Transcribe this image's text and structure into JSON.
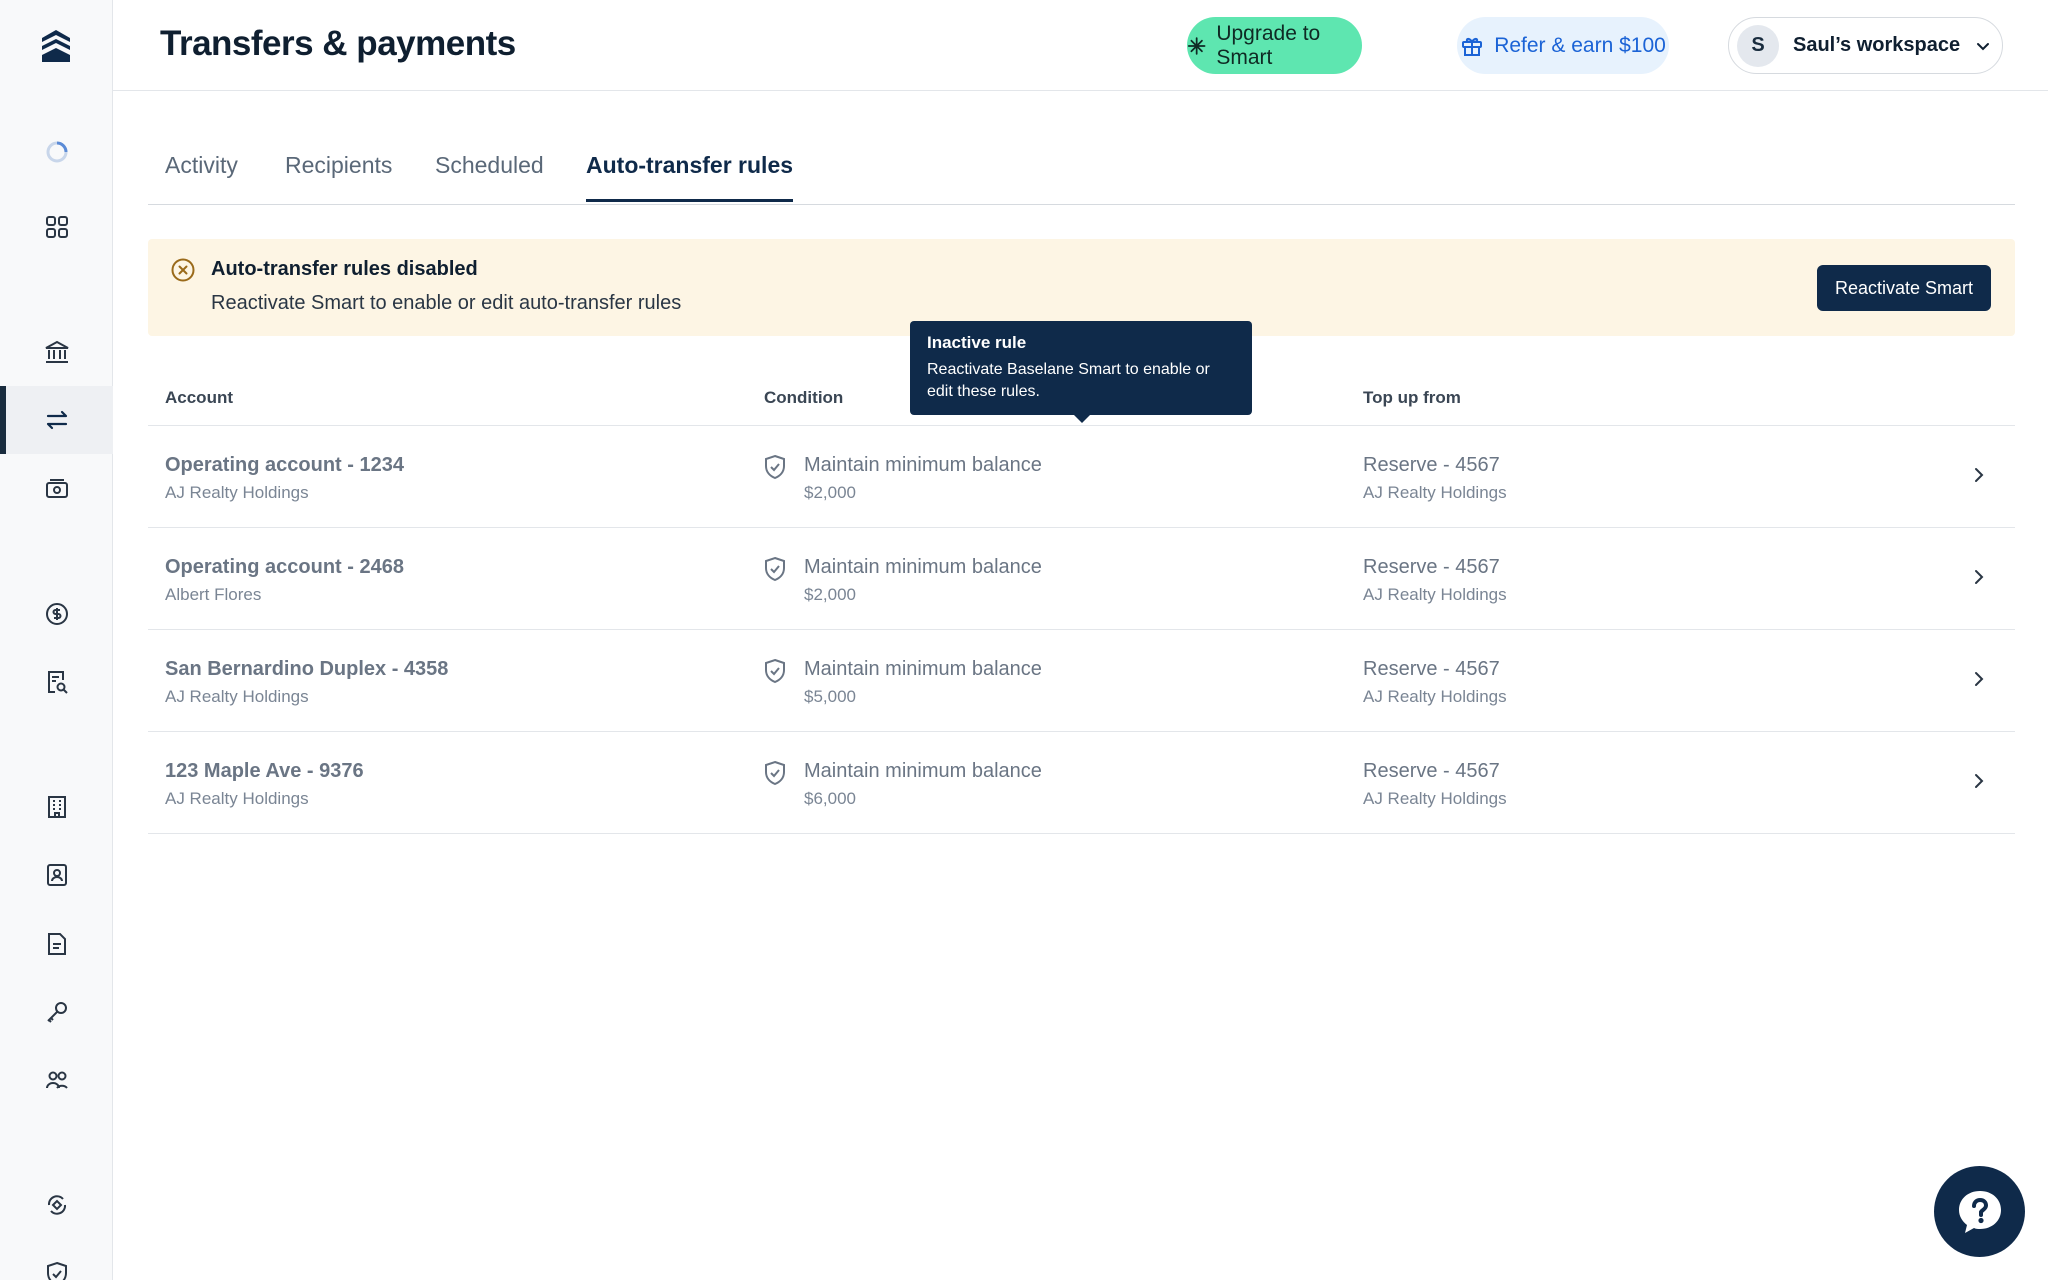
{
  "header": {
    "title": "Transfers & payments",
    "upgrade_label": "Upgrade to Smart",
    "refer_label": "Refer & earn $100",
    "workspace_initial": "S",
    "workspace_name": "Saul’s workspace"
  },
  "tabs": [
    {
      "label": "Activity"
    },
    {
      "label": "Recipients"
    },
    {
      "label": "Scheduled"
    },
    {
      "label": "Auto-transfer rules",
      "active": true
    }
  ],
  "banner": {
    "title": "Auto-transfer rules disabled",
    "description": "Reactivate Smart to enable or edit auto-transfer rules",
    "button_label": "Reactivate Smart"
  },
  "table": {
    "headers": {
      "account": "Account",
      "condition": "Condition",
      "topup": "Top up from"
    },
    "rows": [
      {
        "account": "Operating account - 1234",
        "account_owner": "AJ Realty Holdings",
        "condition": "Maintain minimum balance",
        "amount": "$2,000",
        "source": "Reserve - 4567",
        "source_owner": "AJ Realty Holdings"
      },
      {
        "account": "Operating account - 2468",
        "account_owner": "Albert Flores",
        "condition": "Maintain minimum balance",
        "amount": "$2,000",
        "source": "Reserve - 4567",
        "source_owner": "AJ Realty Holdings"
      },
      {
        "account": "San Bernardino Duplex - 4358",
        "account_owner": "AJ Realty Holdings",
        "condition": "Maintain minimum balance",
        "amount": "$5,000",
        "source": "Reserve - 4567",
        "source_owner": "AJ Realty Holdings"
      },
      {
        "account": "123 Maple Ave - 9376",
        "account_owner": "AJ Realty Holdings",
        "condition": "Maintain minimum balance",
        "amount": "$6,000",
        "source": "Reserve - 4567",
        "source_owner": "AJ Realty Holdings"
      }
    ]
  },
  "tooltip": {
    "title": "Inactive rule",
    "body": "Reactivate Baselane Smart to enable or edit these rules."
  },
  "colors": {
    "brand_dark": "#0f2a4a",
    "upgrade_green": "#5ee6b0",
    "refer_blue": "#1b63d6",
    "banner_bg": "#fdf5e4",
    "warning_icon": "#9a6a1a"
  },
  "sidebar_icons": [
    "logo-icon",
    "loading-icon",
    "dashboard-icon",
    "bank-icon",
    "transfers-icon",
    "cash-icon",
    "dollar-icon",
    "receipt-search-icon",
    "building-icon",
    "tenant-icon",
    "document-icon",
    "key-icon",
    "users-icon",
    "partner-icon",
    "shield-icon"
  ]
}
